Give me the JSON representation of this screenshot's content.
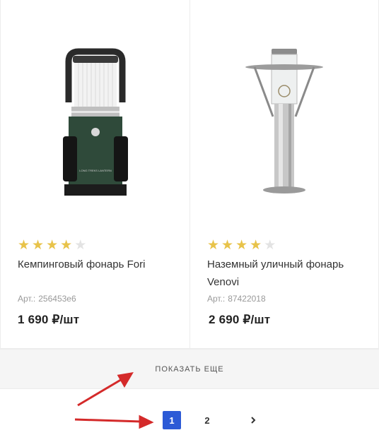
{
  "products": [
    {
      "name": "Кемпинговый фонарь Fori",
      "sku_label": "Арт.:",
      "sku": "256453e6",
      "price": "1 690 ₽/шт",
      "rating": 4,
      "image": "camping-lantern-image"
    },
    {
      "name": "Наземный уличный фонарь Venovi",
      "sku_label": "Арт.:",
      "sku": "87422018",
      "price": "2 690 ₽/шт",
      "rating": 4,
      "image": "garden-lamp-image"
    }
  ],
  "show_more": "ПОКАЗАТЬ ЕЩЕ",
  "pagination": {
    "pages": [
      "1",
      "2"
    ],
    "current": "1",
    "next_icon": "chevron-right-icon"
  },
  "colors": {
    "star": "#e8c34a",
    "star_off": "#e3e3e3",
    "active_page": "#2c5ad6",
    "arrow": "#d42a2a"
  }
}
